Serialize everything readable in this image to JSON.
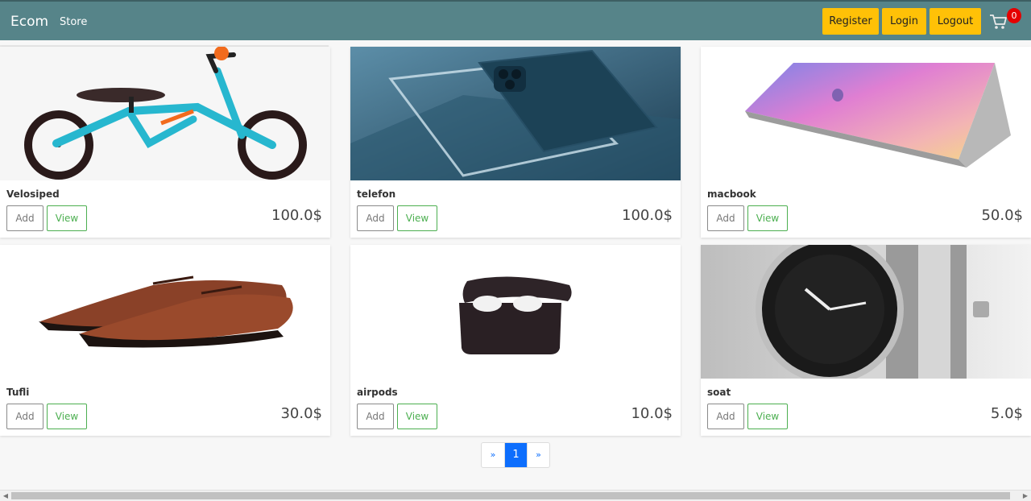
{
  "navbar": {
    "brand": "Ecom",
    "links": [
      "Store"
    ],
    "buttons": {
      "register": "Register",
      "login": "Login",
      "logout": "Logout"
    },
    "cart_count": "0",
    "colors": {
      "bar": "#568489",
      "button": "#ffc107",
      "badge": "#e50000"
    }
  },
  "products": [
    {
      "name": "Velosiped",
      "price": "100.0$",
      "add_label": "Add",
      "view_label": "View",
      "image": "bicycle"
    },
    {
      "name": "telefon",
      "price": "100.0$",
      "add_label": "Add",
      "view_label": "View",
      "image": "phone"
    },
    {
      "name": "macbook",
      "price": "50.0$",
      "add_label": "Add",
      "view_label": "View",
      "image": "laptop"
    },
    {
      "name": "Tufli",
      "price": "30.0$",
      "add_label": "Add",
      "view_label": "View",
      "image": "shoes"
    },
    {
      "name": "airpods",
      "price": "10.0$",
      "add_label": "Add",
      "view_label": "View",
      "image": "earbuds"
    },
    {
      "name": "soat",
      "price": "5.0$",
      "add_label": "Add",
      "view_label": "View",
      "image": "watch"
    }
  ],
  "pagination": {
    "prev": "»",
    "current": "1",
    "next": "»"
  }
}
